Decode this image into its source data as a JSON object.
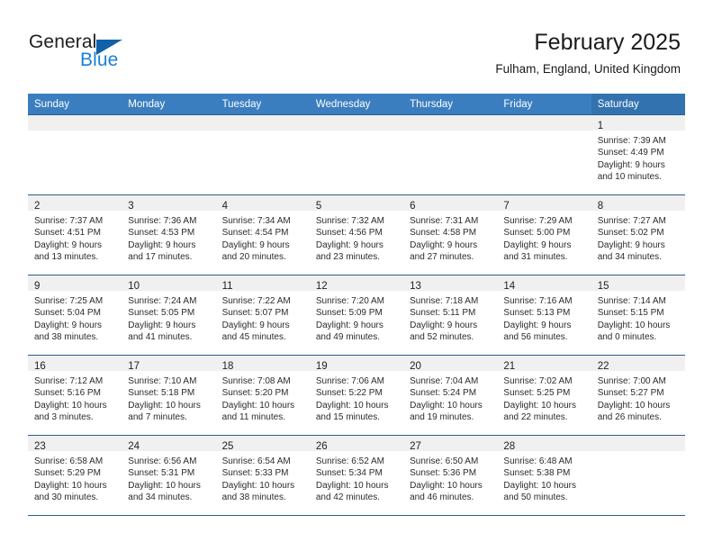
{
  "brand": {
    "word_one": "General",
    "word_two": "Blue",
    "logo_icon": "triangle-logo-icon",
    "accent_color": "#1b7fd4",
    "accent_dark": "#1061a8"
  },
  "header": {
    "title": "February 2025",
    "subtitle": "Fulham, England, United Kingdom"
  },
  "theme": {
    "header_blue": "#3b7ebf",
    "header_blue_saturday": "#3273af",
    "row_rule": "#2a5d8f",
    "daynum_band": "#f0f0f0"
  },
  "calendar": {
    "weekday_headers": [
      "Sunday",
      "Monday",
      "Tuesday",
      "Wednesday",
      "Thursday",
      "Friday",
      "Saturday"
    ],
    "labels": {
      "sunrise": "Sunrise:",
      "sunset": "Sunset:",
      "daylight": "Daylight:"
    },
    "weeks": [
      [
        {
          "day": ""
        },
        {
          "day": ""
        },
        {
          "day": ""
        },
        {
          "day": ""
        },
        {
          "day": ""
        },
        {
          "day": ""
        },
        {
          "day": "1",
          "sunrise": "Sunrise: 7:39 AM",
          "sunset": "Sunset: 4:49 PM",
          "daylight_1": "Daylight: 9 hours",
          "daylight_2": "and 10 minutes."
        }
      ],
      [
        {
          "day": "2",
          "sunrise": "Sunrise: 7:37 AM",
          "sunset": "Sunset: 4:51 PM",
          "daylight_1": "Daylight: 9 hours",
          "daylight_2": "and 13 minutes."
        },
        {
          "day": "3",
          "sunrise": "Sunrise: 7:36 AM",
          "sunset": "Sunset: 4:53 PM",
          "daylight_1": "Daylight: 9 hours",
          "daylight_2": "and 17 minutes."
        },
        {
          "day": "4",
          "sunrise": "Sunrise: 7:34 AM",
          "sunset": "Sunset: 4:54 PM",
          "daylight_1": "Daylight: 9 hours",
          "daylight_2": "and 20 minutes."
        },
        {
          "day": "5",
          "sunrise": "Sunrise: 7:32 AM",
          "sunset": "Sunset: 4:56 PM",
          "daylight_1": "Daylight: 9 hours",
          "daylight_2": "and 23 minutes."
        },
        {
          "day": "6",
          "sunrise": "Sunrise: 7:31 AM",
          "sunset": "Sunset: 4:58 PM",
          "daylight_1": "Daylight: 9 hours",
          "daylight_2": "and 27 minutes."
        },
        {
          "day": "7",
          "sunrise": "Sunrise: 7:29 AM",
          "sunset": "Sunset: 5:00 PM",
          "daylight_1": "Daylight: 9 hours",
          "daylight_2": "and 31 minutes."
        },
        {
          "day": "8",
          "sunrise": "Sunrise: 7:27 AM",
          "sunset": "Sunset: 5:02 PM",
          "daylight_1": "Daylight: 9 hours",
          "daylight_2": "and 34 minutes."
        }
      ],
      [
        {
          "day": "9",
          "sunrise": "Sunrise: 7:25 AM",
          "sunset": "Sunset: 5:04 PM",
          "daylight_1": "Daylight: 9 hours",
          "daylight_2": "and 38 minutes."
        },
        {
          "day": "10",
          "sunrise": "Sunrise: 7:24 AM",
          "sunset": "Sunset: 5:05 PM",
          "daylight_1": "Daylight: 9 hours",
          "daylight_2": "and 41 minutes."
        },
        {
          "day": "11",
          "sunrise": "Sunrise: 7:22 AM",
          "sunset": "Sunset: 5:07 PM",
          "daylight_1": "Daylight: 9 hours",
          "daylight_2": "and 45 minutes."
        },
        {
          "day": "12",
          "sunrise": "Sunrise: 7:20 AM",
          "sunset": "Sunset: 5:09 PM",
          "daylight_1": "Daylight: 9 hours",
          "daylight_2": "and 49 minutes."
        },
        {
          "day": "13",
          "sunrise": "Sunrise: 7:18 AM",
          "sunset": "Sunset: 5:11 PM",
          "daylight_1": "Daylight: 9 hours",
          "daylight_2": "and 52 minutes."
        },
        {
          "day": "14",
          "sunrise": "Sunrise: 7:16 AM",
          "sunset": "Sunset: 5:13 PM",
          "daylight_1": "Daylight: 9 hours",
          "daylight_2": "and 56 minutes."
        },
        {
          "day": "15",
          "sunrise": "Sunrise: 7:14 AM",
          "sunset": "Sunset: 5:15 PM",
          "daylight_1": "Daylight: 10 hours",
          "daylight_2": "and 0 minutes."
        }
      ],
      [
        {
          "day": "16",
          "sunrise": "Sunrise: 7:12 AM",
          "sunset": "Sunset: 5:16 PM",
          "daylight_1": "Daylight: 10 hours",
          "daylight_2": "and 3 minutes."
        },
        {
          "day": "17",
          "sunrise": "Sunrise: 7:10 AM",
          "sunset": "Sunset: 5:18 PM",
          "daylight_1": "Daylight: 10 hours",
          "daylight_2": "and 7 minutes."
        },
        {
          "day": "18",
          "sunrise": "Sunrise: 7:08 AM",
          "sunset": "Sunset: 5:20 PM",
          "daylight_1": "Daylight: 10 hours",
          "daylight_2": "and 11 minutes."
        },
        {
          "day": "19",
          "sunrise": "Sunrise: 7:06 AM",
          "sunset": "Sunset: 5:22 PM",
          "daylight_1": "Daylight: 10 hours",
          "daylight_2": "and 15 minutes."
        },
        {
          "day": "20",
          "sunrise": "Sunrise: 7:04 AM",
          "sunset": "Sunset: 5:24 PM",
          "daylight_1": "Daylight: 10 hours",
          "daylight_2": "and 19 minutes."
        },
        {
          "day": "21",
          "sunrise": "Sunrise: 7:02 AM",
          "sunset": "Sunset: 5:25 PM",
          "daylight_1": "Daylight: 10 hours",
          "daylight_2": "and 22 minutes."
        },
        {
          "day": "22",
          "sunrise": "Sunrise: 7:00 AM",
          "sunset": "Sunset: 5:27 PM",
          "daylight_1": "Daylight: 10 hours",
          "daylight_2": "and 26 minutes."
        }
      ],
      [
        {
          "day": "23",
          "sunrise": "Sunrise: 6:58 AM",
          "sunset": "Sunset: 5:29 PM",
          "daylight_1": "Daylight: 10 hours",
          "daylight_2": "and 30 minutes."
        },
        {
          "day": "24",
          "sunrise": "Sunrise: 6:56 AM",
          "sunset": "Sunset: 5:31 PM",
          "daylight_1": "Daylight: 10 hours",
          "daylight_2": "and 34 minutes."
        },
        {
          "day": "25",
          "sunrise": "Sunrise: 6:54 AM",
          "sunset": "Sunset: 5:33 PM",
          "daylight_1": "Daylight: 10 hours",
          "daylight_2": "and 38 minutes."
        },
        {
          "day": "26",
          "sunrise": "Sunrise: 6:52 AM",
          "sunset": "Sunset: 5:34 PM",
          "daylight_1": "Daylight: 10 hours",
          "daylight_2": "and 42 minutes."
        },
        {
          "day": "27",
          "sunrise": "Sunrise: 6:50 AM",
          "sunset": "Sunset: 5:36 PM",
          "daylight_1": "Daylight: 10 hours",
          "daylight_2": "and 46 minutes."
        },
        {
          "day": "28",
          "sunrise": "Sunrise: 6:48 AM",
          "sunset": "Sunset: 5:38 PM",
          "daylight_1": "Daylight: 10 hours",
          "daylight_2": "and 50 minutes."
        },
        {
          "day": ""
        }
      ]
    ]
  }
}
